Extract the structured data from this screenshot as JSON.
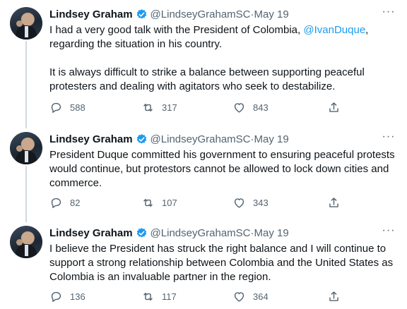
{
  "tweets": [
    {
      "author": "Lindsey Graham",
      "handle": "@LindseyGrahamSC",
      "date": "May 19",
      "text_before_mention": "I had a very good talk with the President of Colombia, ",
      "mention": "@IvanDuque",
      "text_after_mention": ",",
      "text_line2": "regarding the situation in his country.",
      "paragraph2": "It is always difficult to strike a balance between supporting peaceful protesters and dealing with agitators who seek to destabilize.",
      "replies": "588",
      "retweets": "317",
      "likes": "843"
    },
    {
      "author": "Lindsey Graham",
      "handle": "@LindseyGrahamSC",
      "date": "May 19",
      "text": "President Duque committed his government to ensuring peaceful protests would continue, but protestors cannot be allowed to lock down cities and commerce.",
      "replies": "82",
      "retweets": "107",
      "likes": "343"
    },
    {
      "author": "Lindsey Graham",
      "handle": "@LindseyGrahamSC",
      "date": "May 19",
      "text": "I believe the President has struck the right balance and I will continue to support a strong relationship between Colombia and the United States as Colombia is an invaluable partner in the region.",
      "replies": "136",
      "retweets": "117",
      "likes": "364"
    }
  ],
  "separator": " · ",
  "more_glyph": "···",
  "colors": {
    "link": "#1d9bf0",
    "verified": "#1d9bf0",
    "muted": "#536471",
    "thread_line": "#cfd9de"
  },
  "icons": [
    "verified-badge-icon",
    "reply-icon",
    "retweet-icon",
    "like-icon",
    "share-icon",
    "more-icon"
  ]
}
